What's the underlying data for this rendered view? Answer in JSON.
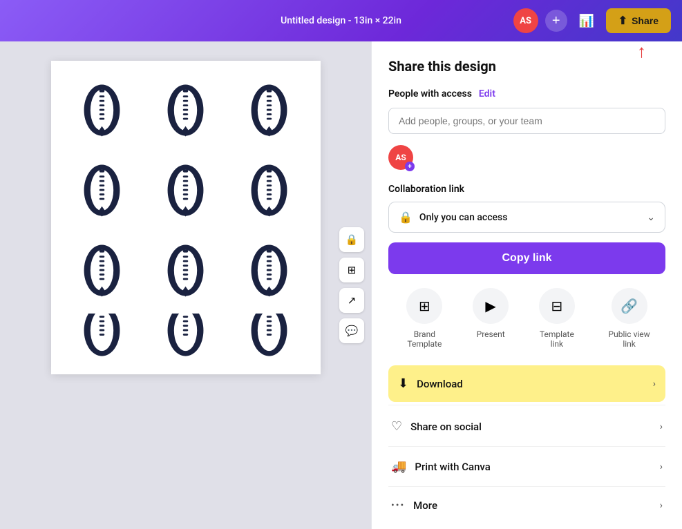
{
  "header": {
    "title": "Untitled design - 13in × 22in",
    "avatar_initials": "AS",
    "share_label": "Share"
  },
  "share_panel": {
    "title": "Share this design",
    "people_access_label": "People with access",
    "edit_label": "Edit",
    "search_placeholder": "Add people, groups, or your team",
    "collab_link_label": "Collaboration link",
    "access_text": "Only you can access",
    "copy_link_label": "Copy link",
    "icons": [
      {
        "label": "Brand Template",
        "icon": "⊞"
      },
      {
        "label": "Present",
        "icon": "▶"
      },
      {
        "label": "Template link",
        "icon": "⊟"
      },
      {
        "label": "Public view link",
        "icon": "🔗"
      }
    ],
    "actions": [
      {
        "label": "Download",
        "icon": "⬇",
        "highlight": true
      },
      {
        "label": "Share on social",
        "icon": "♡",
        "highlight": false
      },
      {
        "label": "Print with Canva",
        "icon": "🚚",
        "highlight": false
      },
      {
        "label": "More",
        "icon": "···",
        "highlight": false
      }
    ]
  }
}
